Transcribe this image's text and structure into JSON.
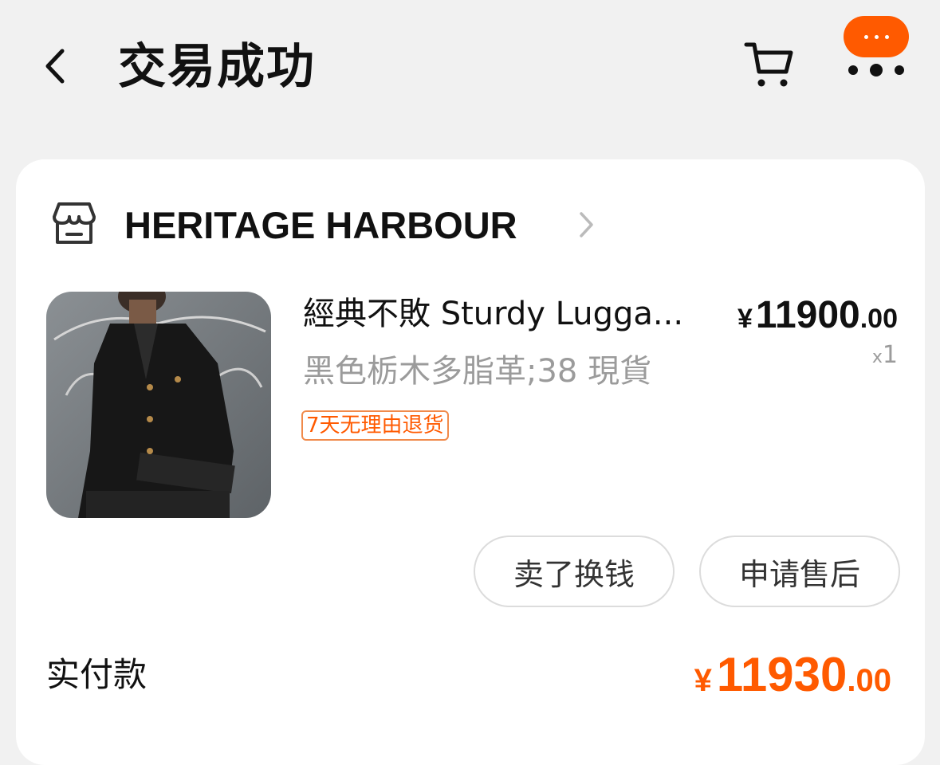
{
  "header": {
    "title": "交易成功",
    "back_icon": "chevron-left-icon",
    "cart_icon": "cart-icon",
    "more_icon": "more-dots-icon",
    "accent_color": "#ff5a00"
  },
  "shop": {
    "name": "HERITAGE HARBOUR",
    "icon": "store-icon"
  },
  "product": {
    "title": "經典不敗 Sturdy Lugga...",
    "sku": "黑色栃木多脂革;38 現貨",
    "badge": "7天无理由退货",
    "price_currency": "¥",
    "price_integer": "11900",
    "price_decimal": ".00",
    "quantity_prefix": "x",
    "quantity": "1",
    "image_description": "man wearing black leather jacket"
  },
  "actions": {
    "sell_label": "卖了换钱",
    "aftersale_label": "申请售后"
  },
  "payment": {
    "label": "实付款",
    "currency": "¥",
    "amount_integer": "11930",
    "amount_decimal": ".00"
  }
}
